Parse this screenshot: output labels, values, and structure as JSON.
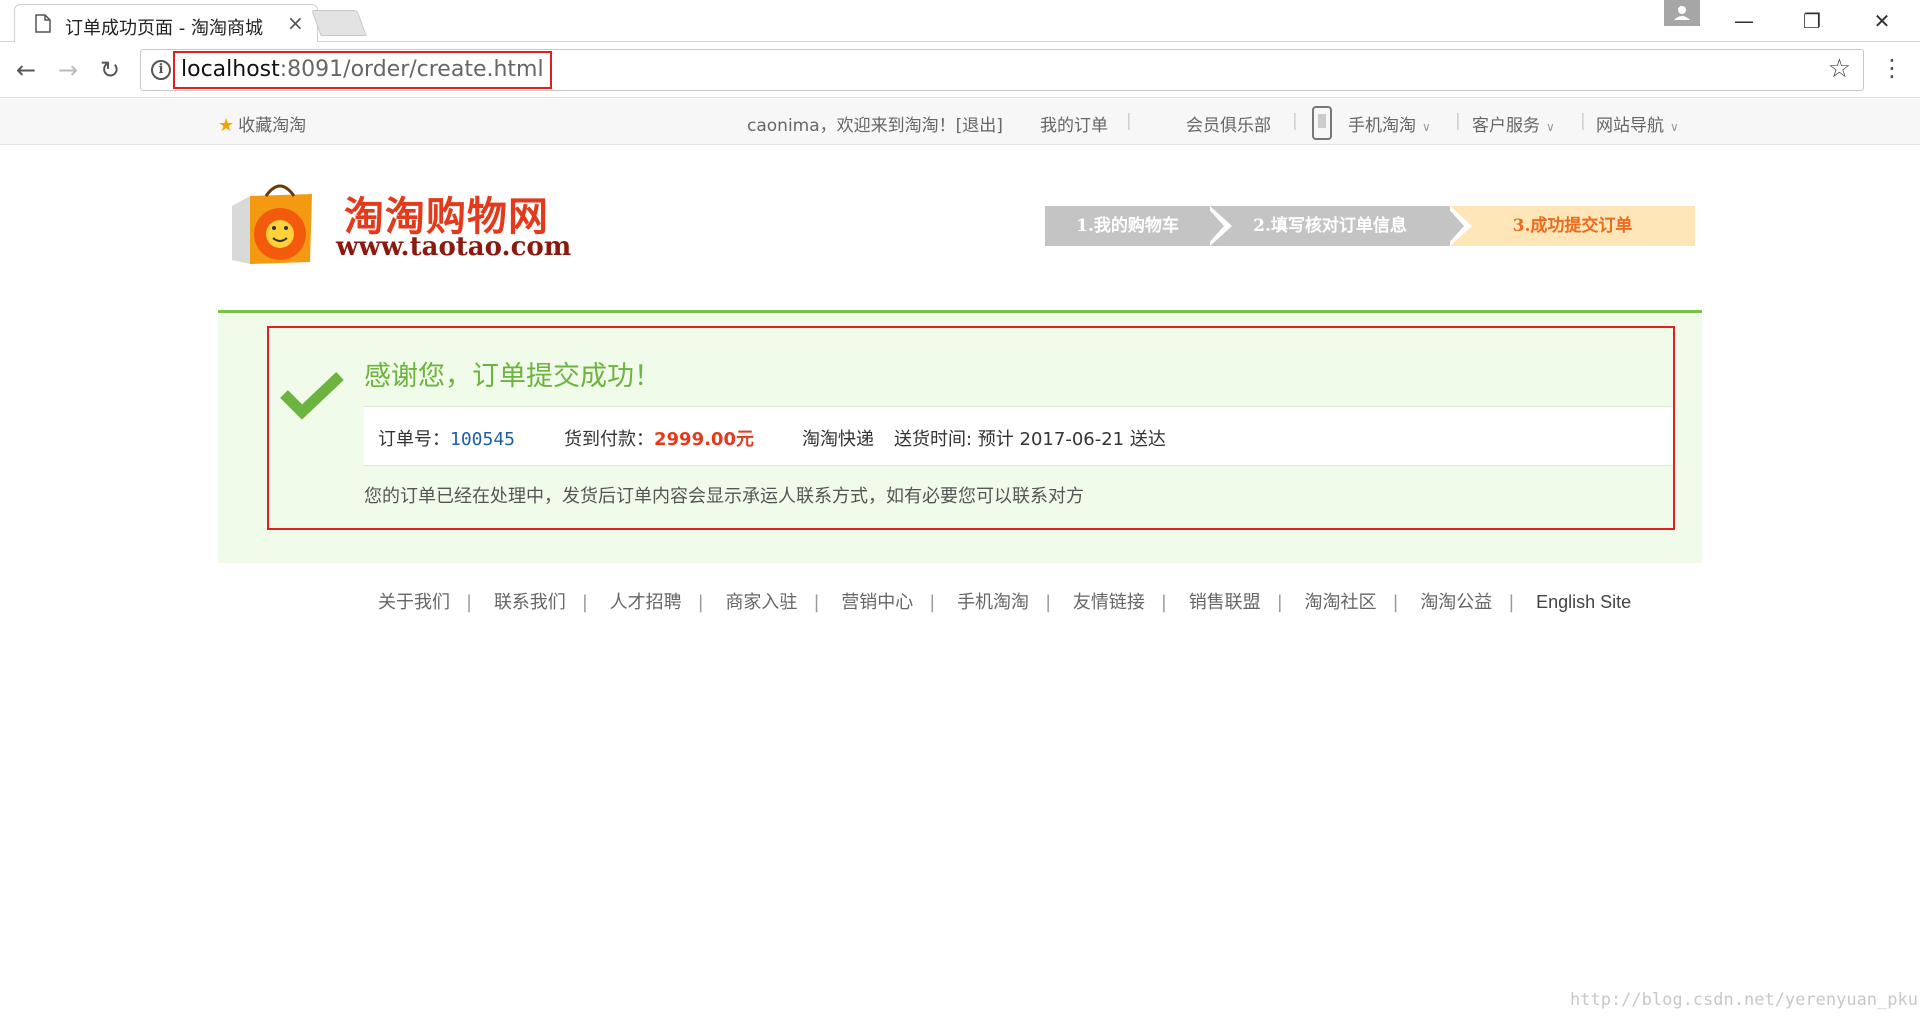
{
  "browser": {
    "tab_title": "订单成功页面 - 淘淘商城",
    "url_host": "localhost",
    "url_rest": ":8091/order/create.html"
  },
  "topbar": {
    "favorite": "收藏淘淘",
    "welcome": "caonima，欢迎来到淘淘！[退出]",
    "my_orders": "我的订单",
    "club": "会员俱乐部",
    "mobile": "手机淘淘",
    "service": "客户服务",
    "site_nav": "网站导航"
  },
  "logo": {
    "name": "淘淘购物网",
    "url": "www.taotao.com"
  },
  "steps": [
    {
      "label": "1.我的购物车"
    },
    {
      "label": "2.填写核对订单信息"
    },
    {
      "label": "3.成功提交订单"
    }
  ],
  "success": {
    "title": "感谢您，订单提交成功！",
    "order_no_label": "订单号：",
    "order_no": "100545",
    "payment_label": "货到付款：",
    "payment_amount": "2999.00元",
    "shipping": "淘淘快递",
    "delivery_label": "送货时间: 预计",
    "delivery_date": "2017-06-21",
    "delivery_suffix": "送达",
    "note": "您的订单已经在处理中，发货后订单内容会显示承运人联系方式，如有必要您可以联系对方"
  },
  "footer": {
    "links": [
      "关于我们",
      "联系我们",
      "人才招聘",
      "商家入驻",
      "营销中心",
      "手机淘淘",
      "友情链接",
      "销售联盟",
      "淘淘社区",
      "淘淘公益"
    ],
    "english": "English Site"
  },
  "watermark": "http://blog.csdn.net/yerenyuan_pku",
  "colors": {
    "accent_green": "#6db33f",
    "price_red": "#e43a1c",
    "step_active": "#ffe6b8",
    "step_inactive": "#c4c4c4"
  }
}
